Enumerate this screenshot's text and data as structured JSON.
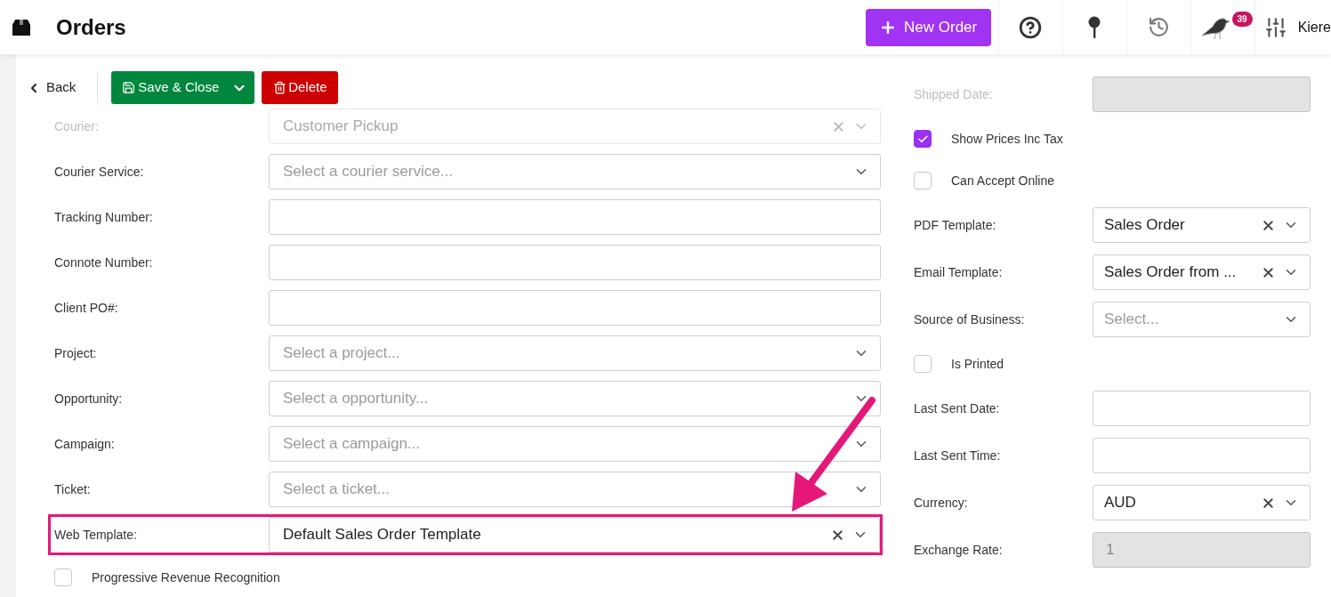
{
  "header": {
    "title": "Orders",
    "new_button": "New Order",
    "notification_count": "39",
    "user": "Kiere"
  },
  "toolbar": {
    "back": "Back",
    "save": "Save & Close",
    "delete": "Delete"
  },
  "left_fields": [
    {
      "kind": "select",
      "label": "Courier:",
      "value": "Customer Pickup",
      "clearable": true,
      "highlighted": false,
      "faded": true
    },
    {
      "kind": "select",
      "label": "Courier Service:",
      "placeholder": "Select a courier service...",
      "clearable": false,
      "highlighted": false,
      "faded": false
    },
    {
      "kind": "text",
      "label": "Tracking Number:",
      "highlighted": false,
      "faded": false
    },
    {
      "kind": "text",
      "label": "Connote Number:",
      "highlighted": false,
      "faded": false
    },
    {
      "kind": "text",
      "label": "Client PO#:",
      "highlighted": false,
      "faded": false
    },
    {
      "kind": "select",
      "label": "Project:",
      "placeholder": "Select a project...",
      "clearable": false,
      "highlighted": false,
      "faded": false
    },
    {
      "kind": "select",
      "label": "Opportunity:",
      "placeholder": "Select a opportunity...",
      "clearable": false,
      "highlighted": false,
      "faded": false
    },
    {
      "kind": "select",
      "label": "Campaign:",
      "placeholder": "Select a campaign...",
      "clearable": false,
      "highlighted": false,
      "faded": false
    },
    {
      "kind": "select",
      "label": "Ticket:",
      "placeholder": "Select a ticket...",
      "clearable": false,
      "highlighted": false,
      "faded": false
    },
    {
      "kind": "select",
      "label": "Web Template:",
      "value": "Default Sales Order Template",
      "clearable": true,
      "highlighted": true,
      "faded": false
    },
    {
      "kind": "checkbox",
      "label": "Progressive Revenue Recognition",
      "checked": false,
      "faded": false
    }
  ],
  "right_fields": [
    {
      "kind": "text",
      "label": "Shipped Date:",
      "disabled": true,
      "faded": true
    },
    {
      "kind": "checkbox",
      "label": "Show Prices Inc Tax",
      "checked": true,
      "faded": false
    },
    {
      "kind": "checkbox",
      "label": "Can Accept Online",
      "checked": false,
      "faded": false
    },
    {
      "kind": "select",
      "label": "PDF Template:",
      "value": "Sales Order",
      "clearable": true,
      "faded": false
    },
    {
      "kind": "select",
      "label": "Email Template:",
      "value": "Sales Order from ...",
      "clearable": true,
      "faded": false
    },
    {
      "kind": "select",
      "label": "Source of Business:",
      "placeholder": "Select...",
      "clearable": false,
      "faded": false
    },
    {
      "kind": "checkbox",
      "label": "Is Printed",
      "checked": false,
      "faded": false
    },
    {
      "kind": "text",
      "label": "Last Sent Date:",
      "disabled": false,
      "faded": false
    },
    {
      "kind": "text",
      "label": "Last Sent Time:",
      "disabled": false,
      "faded": false
    },
    {
      "kind": "select",
      "label": "Currency:",
      "value": "AUD",
      "clearable": true,
      "faded": false
    },
    {
      "kind": "text",
      "label": "Exchange Rate:",
      "value": "1",
      "disabled": true,
      "faded": false
    }
  ]
}
